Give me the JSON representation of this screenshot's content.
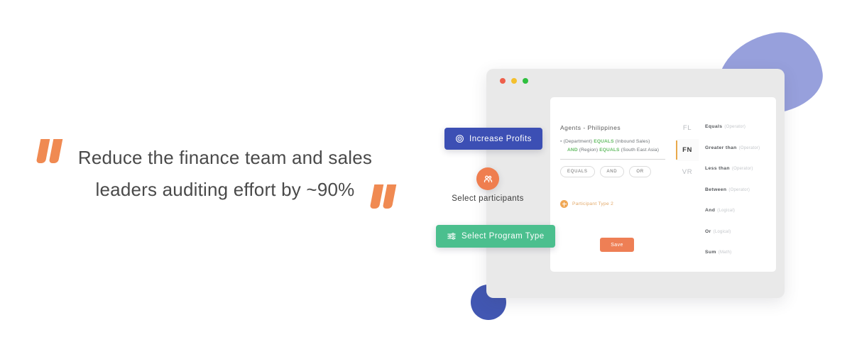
{
  "quote": {
    "text": "Reduce the finance team and sales leaders auditing effort by ~90%",
    "open_quote_icon": "quote-open-icon",
    "close_quote_icon": "quote-close-icon",
    "accent_color": "#F08A52"
  },
  "decor": {
    "blob_color": "#97A0DC",
    "circle_color": "#4257B2"
  },
  "window": {
    "traffic_lights": [
      {
        "name": "close",
        "color": "#EE5F4B"
      },
      {
        "name": "minimize",
        "color": "#F4C02E"
      },
      {
        "name": "maximize",
        "color": "#2FBF3F"
      }
    ],
    "background": "#E9E9E9"
  },
  "card": {
    "rule_builder": {
      "title": "Agents - Philippines",
      "rows": [
        {
          "bullet": "▪",
          "parts": [
            {
              "text": "(Department)",
              "style": "term"
            },
            {
              "text": "EQUALS",
              "style": "keyword"
            },
            {
              "text": "(Inbound Sales)",
              "style": "term"
            }
          ]
        },
        {
          "bullet": "",
          "parts": [
            {
              "text": "AND",
              "style": "keyword"
            },
            {
              "text": "(Region)",
              "style": "term"
            },
            {
              "text": "EQUALS",
              "style": "keyword"
            },
            {
              "text": "(South East Asia)",
              "style": "term"
            }
          ]
        }
      ],
      "chips": [
        "EQUALS",
        "AND",
        "OR"
      ],
      "keyword_color": "#64BC64"
    },
    "participant_type": {
      "label": "Participant Type 2",
      "icon": "plus-circle-icon",
      "color": "#E2A766"
    },
    "save_button": {
      "label": "Save",
      "color": "#EE7F55"
    },
    "rail": {
      "items": [
        {
          "label": "FL",
          "active": false
        },
        {
          "label": "FN",
          "active": true
        },
        {
          "label": "VR",
          "active": false
        }
      ],
      "active_indicator_color": "#E9A94B"
    },
    "operators": [
      {
        "name": "Equals",
        "kind": "(Operator)"
      },
      {
        "name": "Greater than",
        "kind": "(Operator)"
      },
      {
        "name": "Less than",
        "kind": "(Operator)"
      },
      {
        "name": "Between",
        "kind": "(Operator)"
      },
      {
        "name": "And",
        "kind": "(Logical)"
      },
      {
        "name": "Or",
        "kind": "(Logical)"
      },
      {
        "name": "Sum",
        "kind": "(Math)"
      }
    ]
  },
  "floating": {
    "increase_profits": {
      "label": "Increase Profits",
      "icon": "target-icon",
      "color": "#3C4FB4"
    },
    "select_participants": {
      "label": "Select participants",
      "icon": "people-group-icon",
      "color": "#EF7E4F"
    },
    "select_program_type": {
      "label": "Select Program Type",
      "icon": "sliders-icon",
      "color": "#4BBF8E"
    }
  }
}
